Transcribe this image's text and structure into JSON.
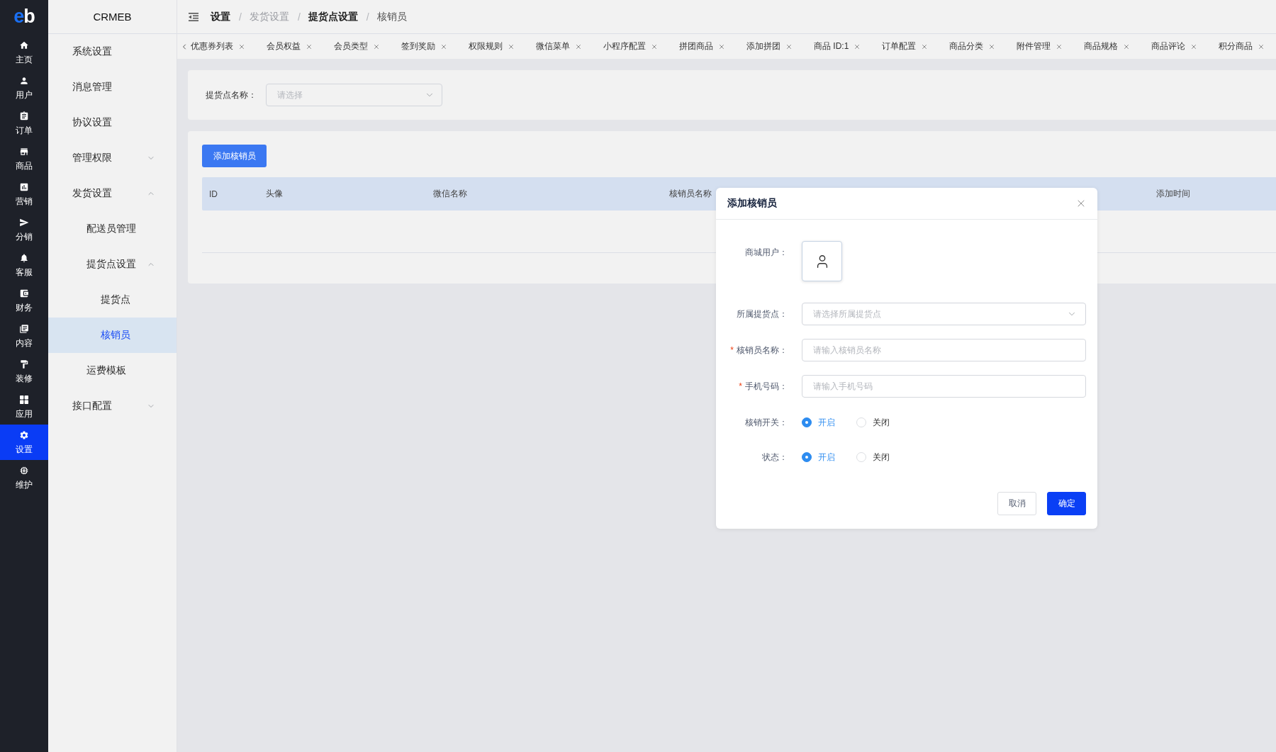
{
  "sidebar": {
    "logo": "eb",
    "items": [
      {
        "label": "主页",
        "selected": false
      },
      {
        "label": "用户",
        "selected": false
      },
      {
        "label": "订单",
        "selected": false
      },
      {
        "label": "商品",
        "selected": false
      },
      {
        "label": "营销",
        "selected": false
      },
      {
        "label": "分销",
        "selected": false
      },
      {
        "label": "客服",
        "selected": false
      },
      {
        "label": "财务",
        "selected": false
      },
      {
        "label": "内容",
        "selected": false
      },
      {
        "label": "装修",
        "selected": false
      },
      {
        "label": "应用",
        "selected": false
      },
      {
        "label": "设置",
        "selected": true
      },
      {
        "label": "维护",
        "selected": false
      }
    ]
  },
  "submenu": {
    "title": "CRMEB",
    "items": [
      {
        "label": "系统设置",
        "selected": false
      },
      {
        "label": "消息管理",
        "selected": false
      },
      {
        "label": "协议设置",
        "selected": false
      },
      {
        "label": "管理权限",
        "selected": false,
        "expanded": false
      },
      {
        "label": "发货设置",
        "selected": false,
        "expanded": true,
        "children": [
          {
            "label": "配送员管理",
            "selected": false
          },
          {
            "label": "提货点设置",
            "selected": false,
            "expanded": true,
            "children": [
              {
                "label": "提货点",
                "selected": false
              },
              {
                "label": "核销员",
                "selected": true
              }
            ]
          },
          {
            "label": "运费模板",
            "selected": false
          }
        ]
      },
      {
        "label": "接口配置",
        "selected": false,
        "expanded": false
      }
    ]
  },
  "header": {
    "breadcrumb": {
      "separator": "/",
      "items": [
        {
          "label": "设置",
          "kind": "strong"
        },
        {
          "label": "发货设置",
          "kind": "muted"
        },
        {
          "label": "提货点设置",
          "kind": "strong"
        },
        {
          "label": "核销员",
          "kind": "current"
        }
      ]
    }
  },
  "tabs": [
    {
      "label": "优惠券列表",
      "selected": false
    },
    {
      "label": "会员权益",
      "selected": false
    },
    {
      "label": "会员类型",
      "selected": false
    },
    {
      "label": "签到奖励",
      "selected": false
    },
    {
      "label": "权限规则",
      "selected": false
    },
    {
      "label": "微信菜单",
      "selected": false
    },
    {
      "label": "小程序配置",
      "selected": false
    },
    {
      "label": "拼团商品",
      "selected": false
    },
    {
      "label": "添加拼团",
      "selected": false
    },
    {
      "label": "商品 ID:1",
      "selected": false
    },
    {
      "label": "订单配置",
      "selected": false
    },
    {
      "label": "商品分类",
      "selected": false
    },
    {
      "label": "附件管理",
      "selected": false
    },
    {
      "label": "商品规格",
      "selected": false
    },
    {
      "label": "商品评论",
      "selected": false
    },
    {
      "label": "积分商品",
      "selected": false
    }
  ],
  "filter": {
    "label": "提货点名称：",
    "placeholder": "请选择"
  },
  "toolbar": {
    "add_button": "添加核销员"
  },
  "table": {
    "columns": [
      "ID",
      "头像",
      "微信名称",
      "核销员名称",
      "添加时间"
    ]
  },
  "dialog": {
    "title": "添加核销员",
    "required_mark": "*",
    "fields": [
      {
        "kind": "avatar",
        "label": "商城用户：",
        "required": false
      },
      {
        "kind": "select",
        "label": "所属提货点：",
        "placeholder": "请选择所属提货点",
        "required": false
      },
      {
        "kind": "input",
        "label": "核销员名称：",
        "placeholder": "请输入核销员名称",
        "required": true
      },
      {
        "kind": "input",
        "label": "手机号码：",
        "placeholder": "请输入手机号码",
        "required": true
      },
      {
        "kind": "radio",
        "label": "核销开关：",
        "required": false,
        "options": [
          {
            "label": "开启",
            "selected": true
          },
          {
            "label": "关闭",
            "selected": false
          }
        ]
      },
      {
        "kind": "radio",
        "label": "状态：",
        "required": false,
        "options": [
          {
            "label": "开启",
            "selected": true
          },
          {
            "label": "关闭",
            "selected": false
          }
        ]
      }
    ],
    "buttons": [
      {
        "label": "取消",
        "kind": "default"
      },
      {
        "label": "确定",
        "kind": "primary"
      }
    ]
  }
}
